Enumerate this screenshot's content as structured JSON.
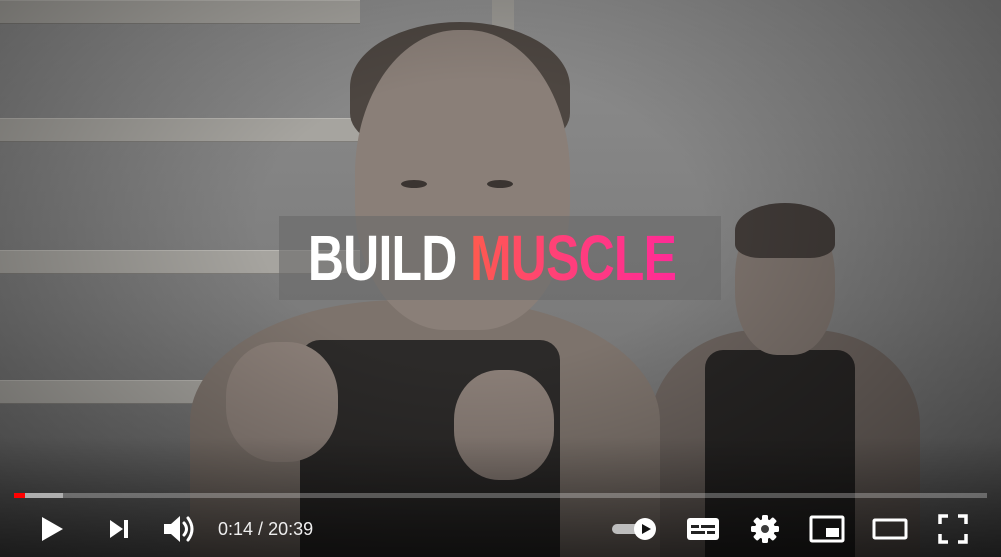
{
  "video": {
    "caption_word_1": "BUILD",
    "caption_word_2": "MUSCLE",
    "caption_colors": {
      "primary": "#ffffff",
      "gradient_start": "#ff5a4e",
      "gradient_end": "#ff2b96"
    }
  },
  "player": {
    "progress": {
      "played_fraction": 0.0114,
      "buffered_fraction": 0.05,
      "played_color": "#ff0000"
    },
    "current_time": "0:14",
    "separator": " / ",
    "duration": "20:39",
    "controls": {
      "left": [
        "play-icon",
        "next-icon",
        "volume-icon"
      ],
      "right": [
        "autoplay-toggle-icon",
        "subtitles-icon",
        "settings-gear-icon",
        "miniplayer-icon",
        "theater-mode-icon",
        "fullscreen-icon"
      ]
    }
  }
}
